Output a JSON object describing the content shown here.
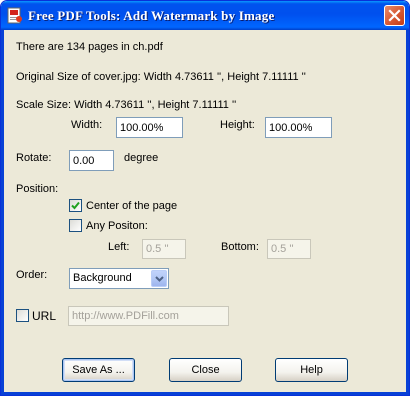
{
  "window": {
    "title": "Free PDF Tools: Add Watermark by Image",
    "icon": "pdf-tools-icon"
  },
  "info": {
    "page_count_text": "There are 134 pages in ch.pdf",
    "original_size_text": "Original Size of cover.jpg:  Width 4.73611 '',   Height 7.11111 ''",
    "scale_size_text": "Scale Size:  Width 4.73611 '',   Height 7.11111 ''"
  },
  "scale": {
    "width_label": "Width:",
    "width_value": "100.00%",
    "height_label": "Height:",
    "height_value": "100.00%"
  },
  "rotate": {
    "label": "Rotate:",
    "value": "0.00",
    "unit": "degree"
  },
  "position": {
    "label": "Position:",
    "center_label": "Center of the page",
    "center_checked": true,
    "any_label": "Any Positon:",
    "any_checked": false,
    "left_label": "Left:",
    "left_value": "0.5 ''",
    "bottom_label": "Bottom:",
    "bottom_value": "0.5 ''"
  },
  "order": {
    "label": "Order:",
    "selected": "Background"
  },
  "url": {
    "label": "URL",
    "checked": false,
    "value": "http://www.PDFill.com"
  },
  "buttons": {
    "save_as": "Save As ...",
    "close": "Close",
    "help": "Help"
  },
  "colors": {
    "titlebar": "#0053ee",
    "dialog_bg": "#ece9d8",
    "checkmark": "#21a121"
  }
}
